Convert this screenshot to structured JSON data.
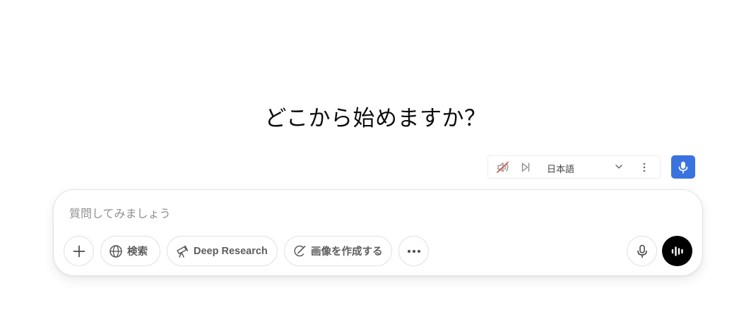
{
  "headline": "どこから始めますか？",
  "voice_toolbar": {
    "language": "日本語",
    "icons": {
      "mute": "speaker-muted-icon",
      "play": "play-next-icon",
      "chevron": "chevron-down-icon",
      "more": "vertical-dots-icon",
      "mic": "microphone-icon"
    },
    "accent_color": "#3a73e0",
    "mute_slash_color": "#d84a4a"
  },
  "composer": {
    "placeholder": "質問してみましょう",
    "value": "",
    "buttons": {
      "add_icon": "plus-icon",
      "search_label": "検索",
      "search_icon": "globe-icon",
      "research_label": "Deep Research",
      "research_icon": "telescope-icon",
      "image_label": "画像を作成する",
      "image_icon": "brush-icon",
      "more_icon": "horizontal-dots-icon",
      "dictate_icon": "microphone-icon",
      "voice_mode_icon": "waveform-icon"
    }
  }
}
